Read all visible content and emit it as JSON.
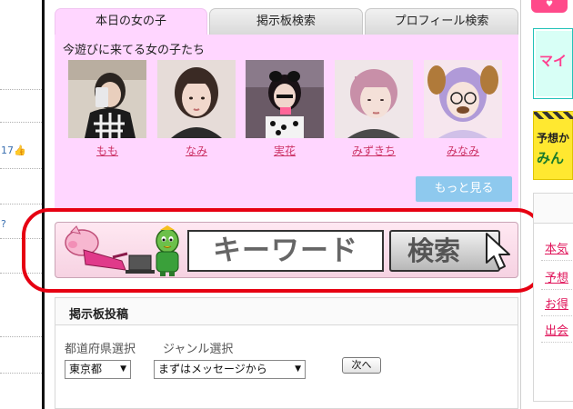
{
  "left_col": {
    "texts": [
      "17",
      "?"
    ]
  },
  "tabs": [
    {
      "label": "本日の女の子",
      "active": true
    },
    {
      "label": "掲示板検索",
      "active": false
    },
    {
      "label": "プロフィール検索",
      "active": false
    }
  ],
  "girls": {
    "heading": "今遊びに来てる女の子たち",
    "items": [
      {
        "name": "もも"
      },
      {
        "name": "なみ"
      },
      {
        "name": "実花"
      },
      {
        "name": "みずきち"
      },
      {
        "name": "みなみ"
      }
    ],
    "more_label": "もっと見る"
  },
  "banner": {
    "keyword_label": "キーワード",
    "search_label": "検索"
  },
  "post": {
    "title": "掲示板投稿",
    "pref_label": "都道府県選択",
    "genre_label": "ジャンル選択",
    "pref_value": "東京都",
    "genre_value": "まずはメッセージから",
    "next_label": "次へ"
  },
  "right_col": {
    "ad_mai": "マイ",
    "ad_yoso1": "予想か",
    "ad_yoso2": "みん",
    "links": [
      "本気",
      "予想",
      "お得",
      "出会"
    ]
  },
  "colors": {
    "panel_pink": "#ffd6ff",
    "link_pink": "#cc3366",
    "highlight_red": "#e60012",
    "more_button_blue": "#8ec9ee"
  }
}
